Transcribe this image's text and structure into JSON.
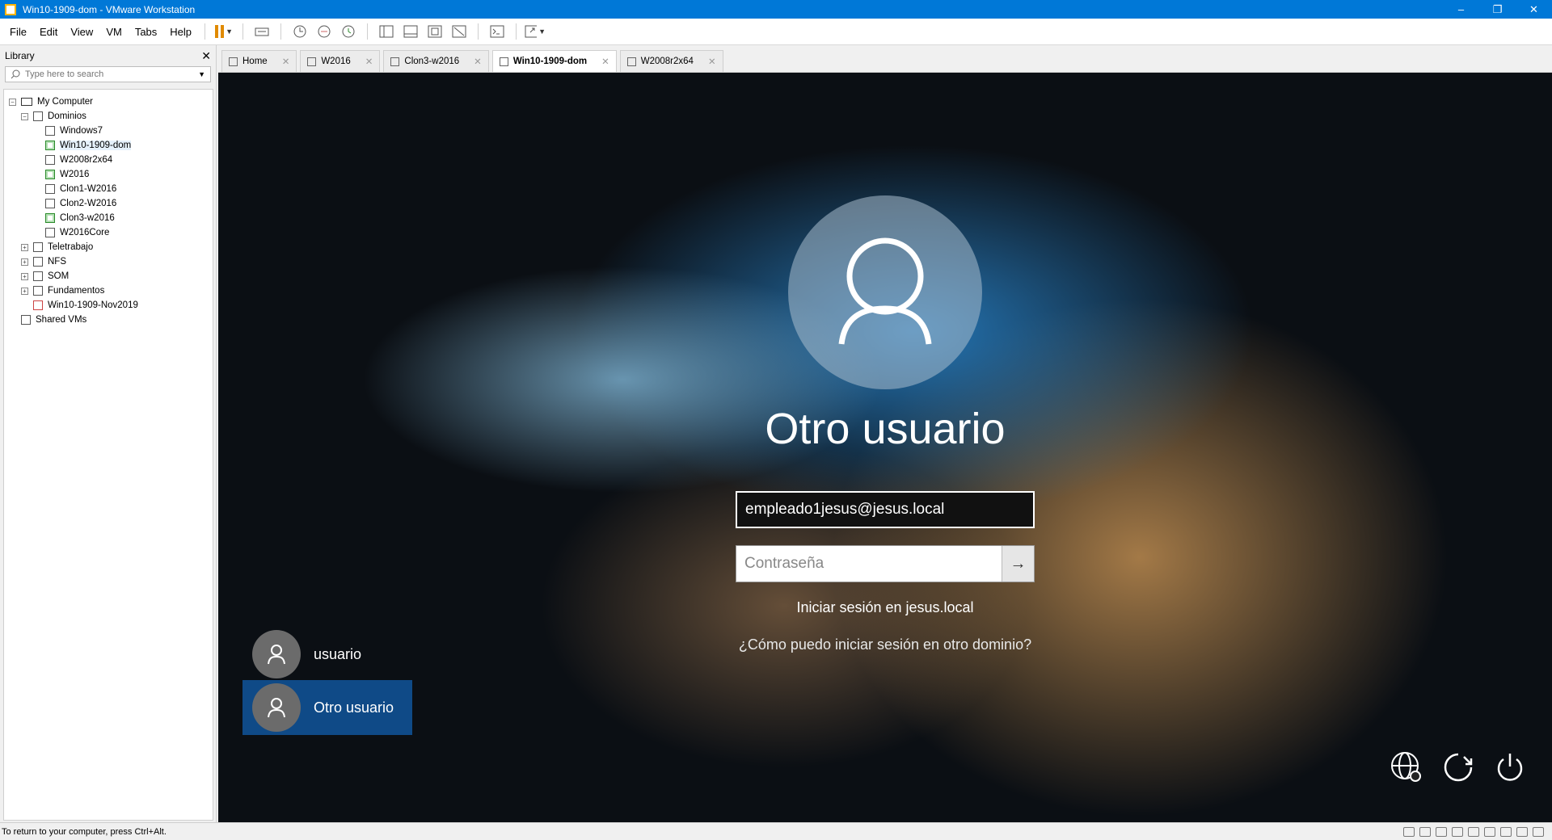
{
  "window": {
    "title": "Win10-1909-dom - VMware Workstation"
  },
  "menu": [
    "File",
    "Edit",
    "View",
    "VM",
    "Tabs",
    "Help"
  ],
  "library": {
    "title": "Library",
    "search_placeholder": "Type here to search",
    "tree": [
      {
        "label": "My Computer",
        "level": 0,
        "expander": "−",
        "icon": "computer-icon"
      },
      {
        "label": "Dominios",
        "level": 1,
        "expander": "−",
        "icon": "folder-icon"
      },
      {
        "label": "Windows7",
        "level": 2,
        "icon": "vm-icon"
      },
      {
        "label": "Win10-1909-dom",
        "level": 2,
        "icon": "vm-running-icon",
        "selected": true
      },
      {
        "label": "W2008r2x64",
        "level": 2,
        "icon": "vm-icon"
      },
      {
        "label": "W2016",
        "level": 2,
        "icon": "vm-running-icon"
      },
      {
        "label": "Clon1-W2016",
        "level": 2,
        "icon": "vm-clone-icon"
      },
      {
        "label": "Clon2-W2016",
        "level": 2,
        "icon": "vm-clone-icon"
      },
      {
        "label": "Clon3-w2016",
        "level": 2,
        "icon": "vm-running-icon"
      },
      {
        "label": "W2016Core",
        "level": 2,
        "icon": "vm-icon"
      },
      {
        "label": "Teletrabajo",
        "level": 1,
        "expander": "+",
        "icon": "folder-icon"
      },
      {
        "label": "NFS",
        "level": 1,
        "expander": "+",
        "icon": "folder-icon"
      },
      {
        "label": "SOM",
        "level": 1,
        "expander": "+",
        "icon": "folder-icon"
      },
      {
        "label": "Fundamentos",
        "level": 1,
        "expander": "+",
        "icon": "folder-icon"
      },
      {
        "label": "Win10-1909-Nov2019",
        "level": 1,
        "icon": "vm-icon"
      },
      {
        "label": "Shared VMs",
        "level": 0,
        "icon": "shared-vms-icon"
      }
    ]
  },
  "tabs": [
    {
      "label": "Home",
      "active": false
    },
    {
      "label": "W2016",
      "active": false
    },
    {
      "label": "Clon3-w2016",
      "active": false
    },
    {
      "label": "Win10-1909-dom",
      "active": true
    },
    {
      "label": "W2008r2x64",
      "active": false
    }
  ],
  "login": {
    "user_title": "Otro usuario",
    "email_value": "empleado1jesus@jesus.local",
    "password_placeholder": "Contraseña",
    "signin_domain": "Iniciar sesión en jesus.local",
    "other_domain_link": "¿Cómo puedo iniciar sesión en otro dominio?",
    "users": [
      {
        "name": "usuario",
        "selected": false
      },
      {
        "name": "Otro usuario",
        "selected": true
      }
    ]
  },
  "status": {
    "text": "To return to your computer, press Ctrl+Alt."
  }
}
